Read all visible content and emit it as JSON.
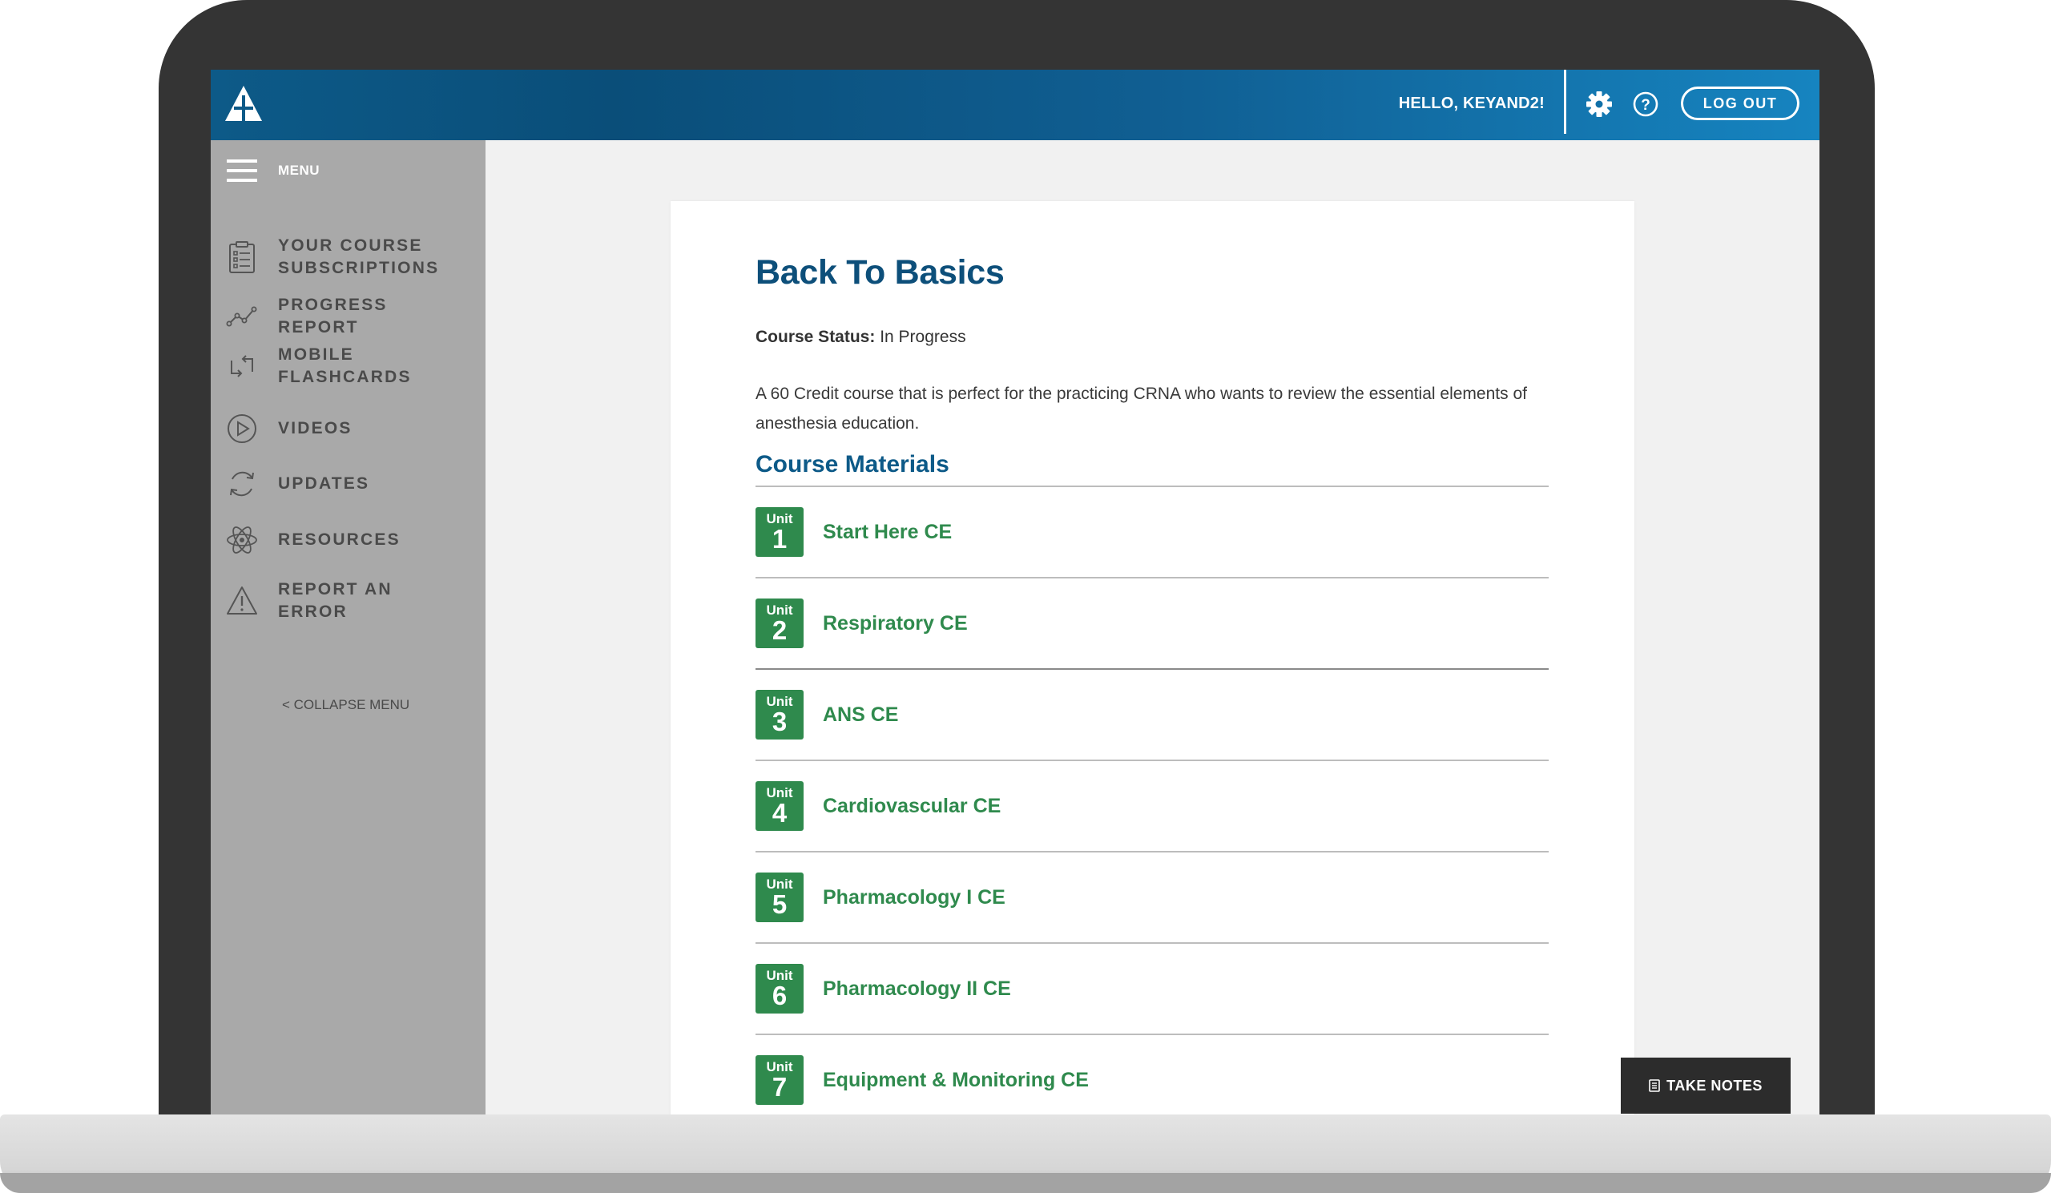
{
  "header": {
    "greeting": "HELLO, KEYAND2!",
    "logout_label": "LOG OUT"
  },
  "sidebar": {
    "menu_label": "MENU",
    "items": [
      {
        "label": "YOUR COURSE SUBSCRIPTIONS",
        "icon": "clipboard-icon"
      },
      {
        "label": "PROGRESS REPORT",
        "icon": "line-graph-icon"
      },
      {
        "label": "MOBILE FLASHCARDS",
        "icon": "flashcards-icon"
      },
      {
        "label": "VIDEOS",
        "icon": "play-icon"
      },
      {
        "label": "UPDATES",
        "icon": "refresh-icon"
      },
      {
        "label": "RESOURCES",
        "icon": "atom-icon"
      },
      {
        "label": "REPORT AN ERROR",
        "icon": "warning-icon"
      }
    ],
    "collapse_label": "< COLLAPSE MENU"
  },
  "course": {
    "title": "Back To Basics",
    "status_label": "Course Status:",
    "status_value": "In Progress",
    "description": "A 60 Credit course that is perfect for the practicing CRNA who wants to review the essential elements of anesthesia education.",
    "materials_heading": "Course Materials",
    "units": [
      {
        "badge_word": "Unit",
        "number": "1",
        "title": "Start Here CE"
      },
      {
        "badge_word": "Unit",
        "number": "2",
        "title": "Respiratory CE"
      },
      {
        "badge_word": "Unit",
        "number": "3",
        "title": "ANS CE"
      },
      {
        "badge_word": "Unit",
        "number": "4",
        "title": "Cardiovascular CE"
      },
      {
        "badge_word": "Unit",
        "number": "5",
        "title": "Pharmacology I CE"
      },
      {
        "badge_word": "Unit",
        "number": "6",
        "title": "Pharmacology II CE"
      },
      {
        "badge_word": "Unit",
        "number": "7",
        "title": "Equipment & Monitoring CE"
      }
    ]
  },
  "take_notes_label": "TAKE NOTES",
  "colors": {
    "header_start": "#0a4e79",
    "header_end": "#1684c0",
    "sidebar_bg": "#a9a9a9",
    "title_blue": "#0d4f7a",
    "unit_green": "#2f8a4d"
  }
}
